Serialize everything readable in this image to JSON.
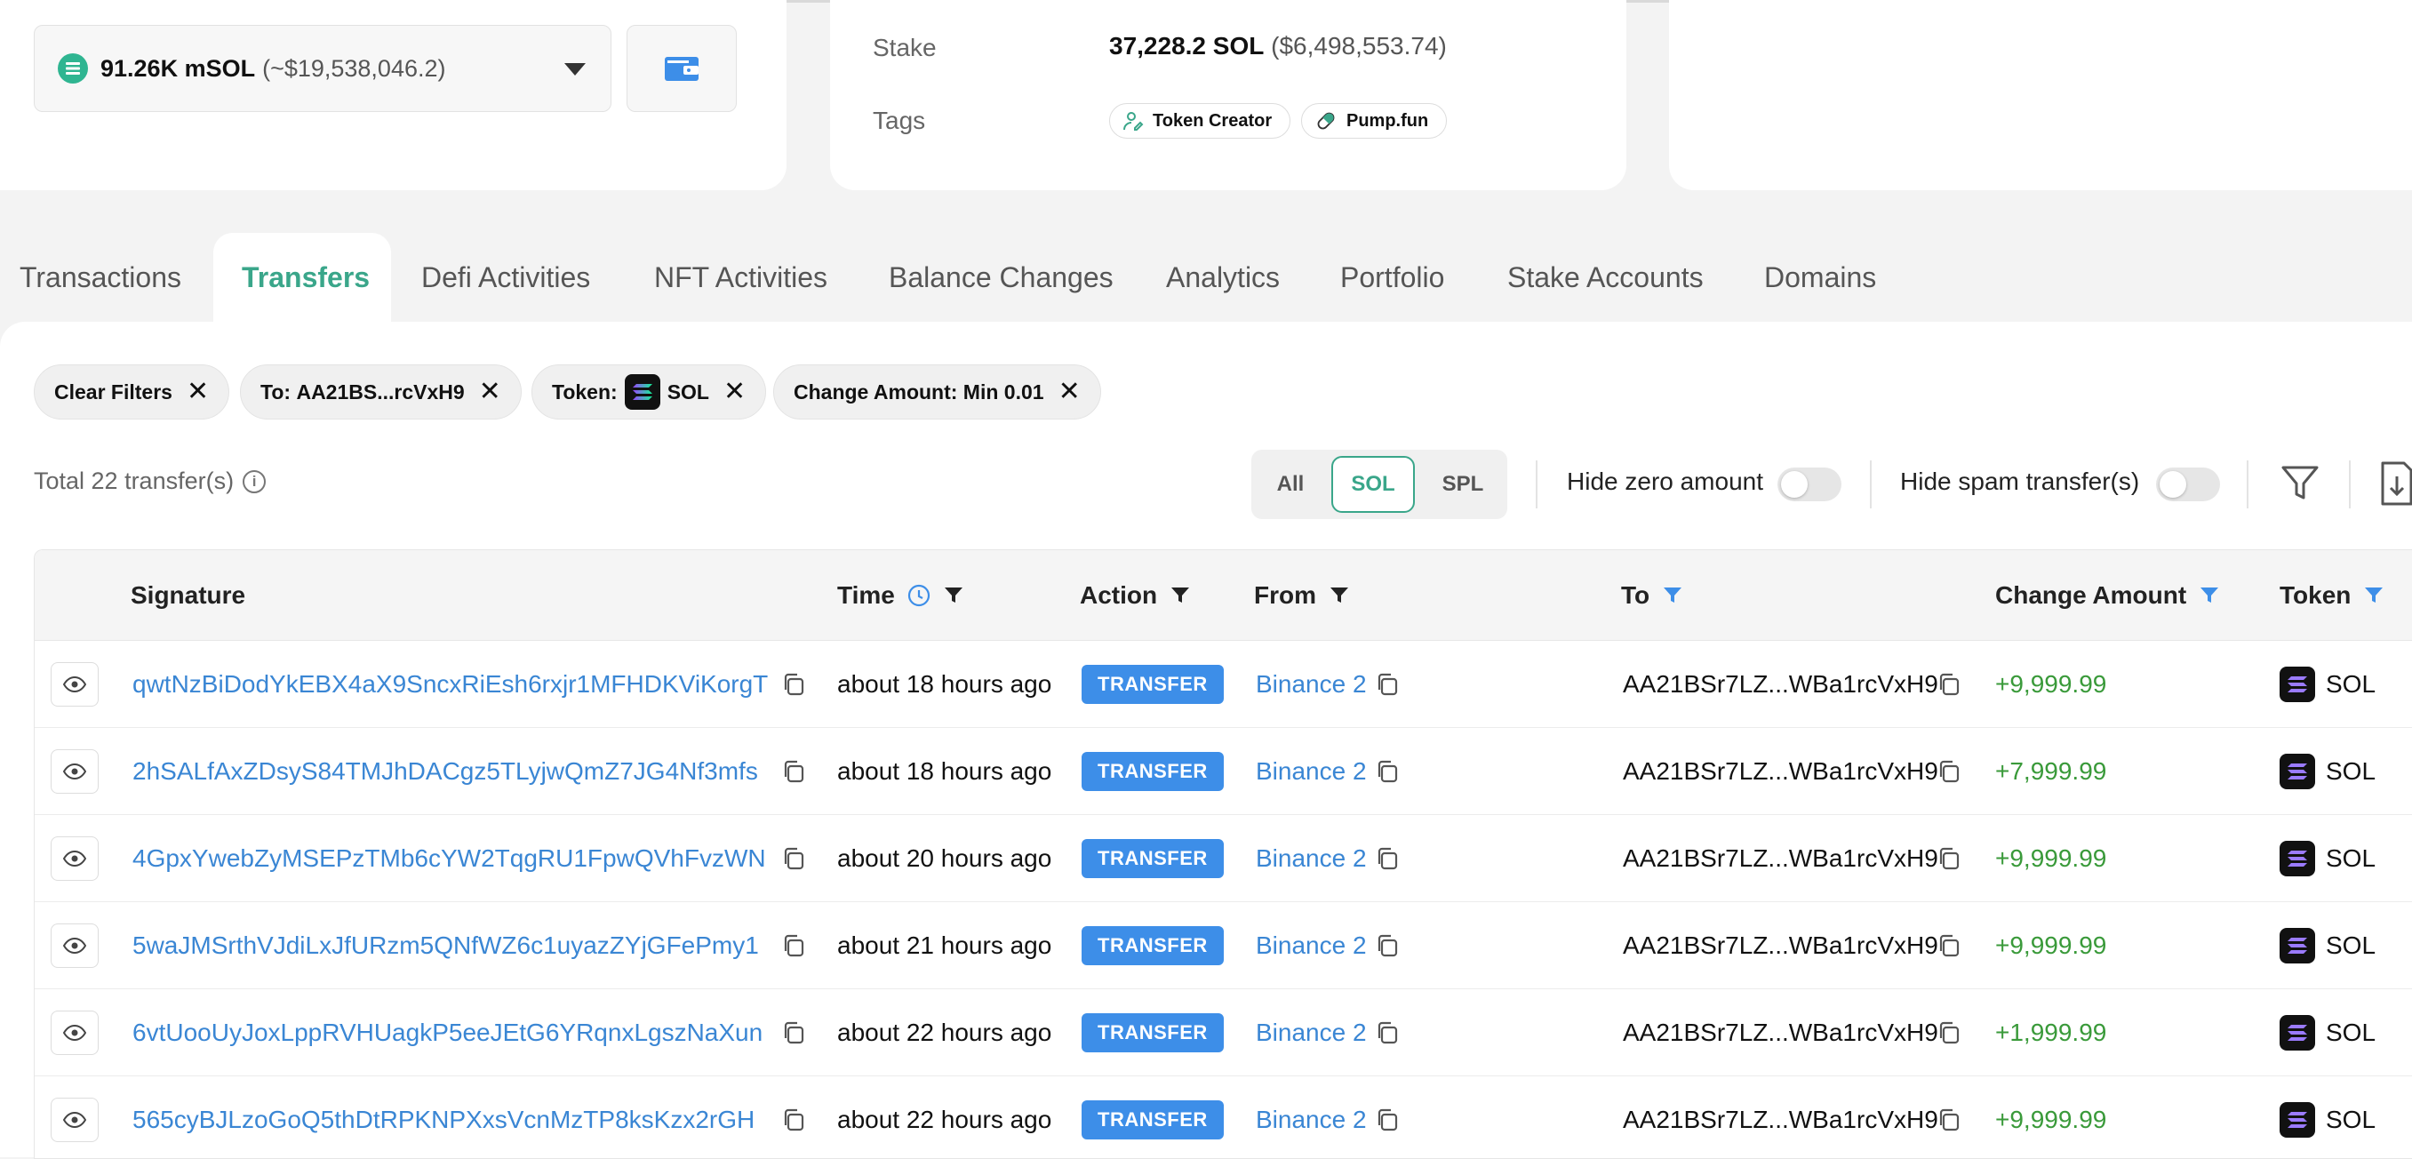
{
  "account": {
    "token_amount": "91.26K mSOL",
    "token_usd": "(~$19,538,046.2)",
    "stake_label": "Stake",
    "stake_value": "37,228.2 SOL",
    "stake_usd": "($6,498,553.74)",
    "tags_label": "Tags",
    "tags": [
      "Token Creator",
      "Pump.fun"
    ]
  },
  "tabs": [
    "Transactions",
    "Transfers",
    "Defi Activities",
    "NFT Activities",
    "Balance Changes",
    "Analytics",
    "Portfolio",
    "Stake Accounts",
    "Domains"
  ],
  "active_tab": "Transfers",
  "filters": {
    "clear_label": "Clear Filters",
    "to_label": "To:",
    "to_value": "AA21BS...rcVxH9",
    "token_label": "Token:",
    "token_value": "SOL",
    "change_label": "Change Amount:",
    "change_value": "Min 0.01"
  },
  "summary": {
    "total_text": "Total 22 transfer(s)",
    "segments": [
      "All",
      "SOL",
      "SPL"
    ],
    "selected_segment": "SOL",
    "hide_zero_label": "Hide zero amount",
    "hide_spam_label": "Hide spam transfer(s)"
  },
  "table": {
    "headers": {
      "signature": "Signature",
      "time": "Time",
      "action": "Action",
      "from": "From",
      "to": "To",
      "change": "Change Amount",
      "token": "Token"
    },
    "rows": [
      {
        "signature": "qwtNzBiDodYkEBX4aX9SncxRiEsh6rxjr1MFHDKViKorgT",
        "time": "about 18 hours ago",
        "action": "TRANSFER",
        "from": "Binance 2",
        "to": "AA21BSr7LZ...WBa1rcVxH9",
        "change": "+9,999.99",
        "token": "SOL"
      },
      {
        "signature": "2hSALfAxZDsyS84TMJhDACgz5TLyjwQmZ7JG4Nf3mfs",
        "time": "about 18 hours ago",
        "action": "TRANSFER",
        "from": "Binance 2",
        "to": "AA21BSr7LZ...WBa1rcVxH9",
        "change": "+7,999.99",
        "token": "SOL"
      },
      {
        "signature": "4GpxYwebZyMSEPzTMb6cYW2TqgRU1FpwQVhFvzWN",
        "time": "about 20 hours ago",
        "action": "TRANSFER",
        "from": "Binance 2",
        "to": "AA21BSr7LZ...WBa1rcVxH9",
        "change": "+9,999.99",
        "token": "SOL"
      },
      {
        "signature": "5waJMSrthVJdiLxJfURzm5QNfWZ6c1uyazZYjGFePmy1",
        "time": "about 21 hours ago",
        "action": "TRANSFER",
        "from": "Binance 2",
        "to": "AA21BSr7LZ...WBa1rcVxH9",
        "change": "+9,999.99",
        "token": "SOL"
      },
      {
        "signature": "6vtUooUyJoxLppRVHUagkP5eeJEtG6YRqnxLgszNaXun",
        "time": "about 22 hours ago",
        "action": "TRANSFER",
        "from": "Binance 2",
        "to": "AA21BSr7LZ...WBa1rcVxH9",
        "change": "+1,999.99",
        "token": "SOL"
      },
      {
        "signature": "565cyBJLzoGoQ5thDtRPKNPXxsVcnMzTP8ksKzx2rGH",
        "time": "about 22 hours ago",
        "action": "TRANSFER",
        "from": "Binance 2",
        "to": "AA21BSr7LZ...WBa1rcVxH9",
        "change": "+9,999.99",
        "token": "SOL"
      }
    ]
  },
  "colors": {
    "accent": "#3aa68a",
    "link": "#3a86d4",
    "badge": "#3d8ee8",
    "positive": "#3a9a3a"
  },
  "icons": [
    "msol-token-icon",
    "wallet-icon",
    "token-creator-icon",
    "pill-icon",
    "close-icon",
    "sol-token-icon",
    "info-icon",
    "filter-icon",
    "download-icon",
    "clock-icon",
    "eye-icon",
    "copy-icon"
  ]
}
